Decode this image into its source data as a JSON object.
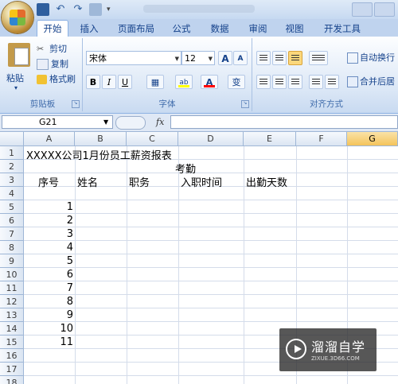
{
  "ribbon": {
    "tabs": [
      "开始",
      "插入",
      "页面布局",
      "公式",
      "数据",
      "审阅",
      "视图",
      "开发工具"
    ],
    "active_tab": "开始",
    "clipboard": {
      "paste": "粘贴",
      "cut": "剪切",
      "copy": "复制",
      "format_painter": "格式刷",
      "group_label": "剪贴板"
    },
    "font": {
      "font_name": "宋体",
      "font_size": "12",
      "grow": "A",
      "shrink": "A",
      "bold": "B",
      "italic": "I",
      "underline": "U",
      "highlight": "ab",
      "font_color": "A",
      "phonetic": "变",
      "group_label": "字体",
      "highlight_color": "#ffff00",
      "font_color_value": "#ff0000"
    },
    "alignment": {
      "wrap_text": "自动换行",
      "merge_center": "合并后居",
      "group_label": "对齐方式"
    }
  },
  "formula_bar": {
    "name_box": "G21",
    "fx": "fx",
    "formula": ""
  },
  "sheet": {
    "columns": [
      "A",
      "B",
      "C",
      "D",
      "E",
      "F",
      "G"
    ],
    "selected_column": "G",
    "rows": [
      "1",
      "2",
      "3",
      "4",
      "5",
      "6",
      "7",
      "8",
      "9",
      "10",
      "11",
      "12",
      "13",
      "14",
      "15",
      "16",
      "17",
      "18"
    ],
    "title_cell": "XXXXX公司1月份员工薪资报表",
    "attendance_header": "考勤",
    "headers": {
      "seq": "序号",
      "name": "姓名",
      "position": "职务",
      "hire_date": "入职时间",
      "attendance_days": "出勤天数"
    },
    "seq_numbers": [
      "1",
      "2",
      "3",
      "4",
      "5",
      "6",
      "7",
      "8",
      "9",
      "10",
      "11"
    ]
  },
  "watermark": {
    "title": "溜溜自学",
    "url": "ZIXUE.3D66.COM"
  }
}
